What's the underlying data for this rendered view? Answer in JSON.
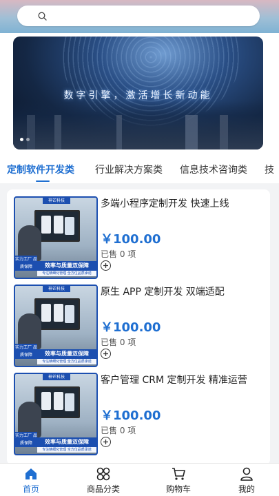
{
  "search": {
    "placeholder": ""
  },
  "banner": {
    "text": "数字引擎，激活增长新动能",
    "dots": 2,
    "active_dot": 0
  },
  "tabs": [
    {
      "label": "定制软件开发类",
      "active": true
    },
    {
      "label": "行业解决方案类",
      "active": false
    },
    {
      "label": "信息技术咨询类",
      "active": false
    },
    {
      "label": "技",
      "active": false
    }
  ],
  "products": [
    {
      "title": "多端小程序定制开发 快速上线",
      "price": "￥100.00",
      "sold": "已售 0 项",
      "thumb": {
        "brand": "神芒科技",
        "badge_left": "实力工厂 品质保障",
        "badge_bar": "效率与质量双保障",
        "badge_sub": "专注精细化管理  全方位品质承诺"
      }
    },
    {
      "title": "原生 APP 定制开发 双端适配",
      "price": "￥100.00",
      "sold": "已售 0 项",
      "thumb": {
        "brand": "神芒科技",
        "badge_left": "实力工厂 品质保障",
        "badge_bar": "效率与质量双保障",
        "badge_sub": "专注精细化管理  全方位品质承诺"
      }
    },
    {
      "title": "客户管理 CRM 定制开发 精准运营",
      "price": "￥100.00",
      "sold": "已售 0 项",
      "thumb": {
        "brand": "神芒科技",
        "badge_left": "实力工厂 品质保障",
        "badge_bar": "效率与质量双保障",
        "badge_sub": "专注精细化管理  全方位品质承诺"
      }
    }
  ],
  "nav": [
    {
      "label": "首页",
      "icon": "home-icon",
      "active": true
    },
    {
      "label": "商品分类",
      "icon": "category-icon",
      "active": false
    },
    {
      "label": "购物车",
      "icon": "cart-icon",
      "active": false
    },
    {
      "label": "我的",
      "icon": "profile-icon",
      "active": false
    }
  ],
  "colors": {
    "accent": "#1f6fd1",
    "badge_blue": "#1c4fb0"
  }
}
